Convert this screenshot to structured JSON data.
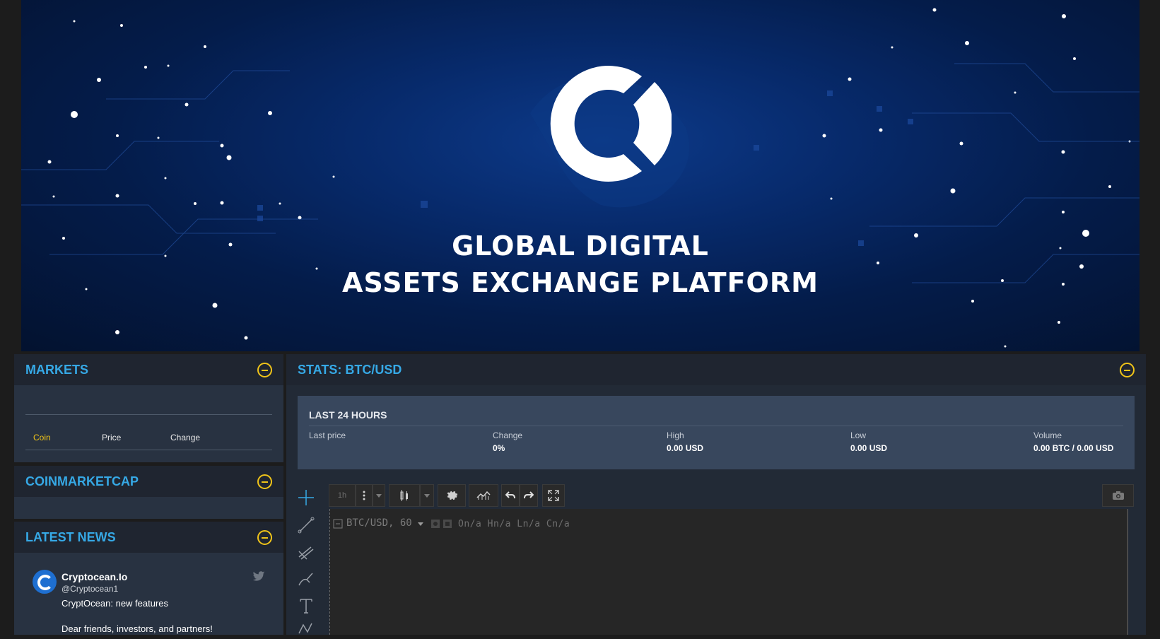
{
  "banner": {
    "headline_line1": "GLOBAL DIGITAL",
    "headline_line2": "ASSETS EXCHANGE PLATFORM",
    "logo_icon": "cryptocean-logo"
  },
  "markets": {
    "title": "MARKETS",
    "columns": [
      "Coin",
      "Price",
      "Change"
    ],
    "active_column": "Coin"
  },
  "coinmarketcap": {
    "title": "COINMARKETCAP"
  },
  "news": {
    "title": "LATEST NEWS",
    "item": {
      "author": "Cryptocean.Io",
      "handle": "@Cryptocean1",
      "headline": "CryptOcean: new features",
      "body": "Dear friends, investors, and partners!"
    }
  },
  "stats": {
    "title": "STATS: BTC/USD",
    "section": "LAST 24 HOURS",
    "fields": [
      {
        "label": "Last price",
        "value": ""
      },
      {
        "label": "Change",
        "value": "0%"
      },
      {
        "label": "High",
        "value": "0.00 USD"
      },
      {
        "label": "Low",
        "value": "0.00 USD"
      },
      {
        "label": "Volume",
        "value": "0.00 BTC / 0.00 USD"
      }
    ]
  },
  "chart": {
    "interval": "1h",
    "symbol": "BTC/USD, 60",
    "ohlc": "On/a  Hn/a  Ln/a  Cn/a"
  },
  "colors": {
    "accent_blue": "#36a9e6",
    "accent_yellow": "#f0c419",
    "panel_header": "#1f2530",
    "panel_body": "#283241"
  }
}
